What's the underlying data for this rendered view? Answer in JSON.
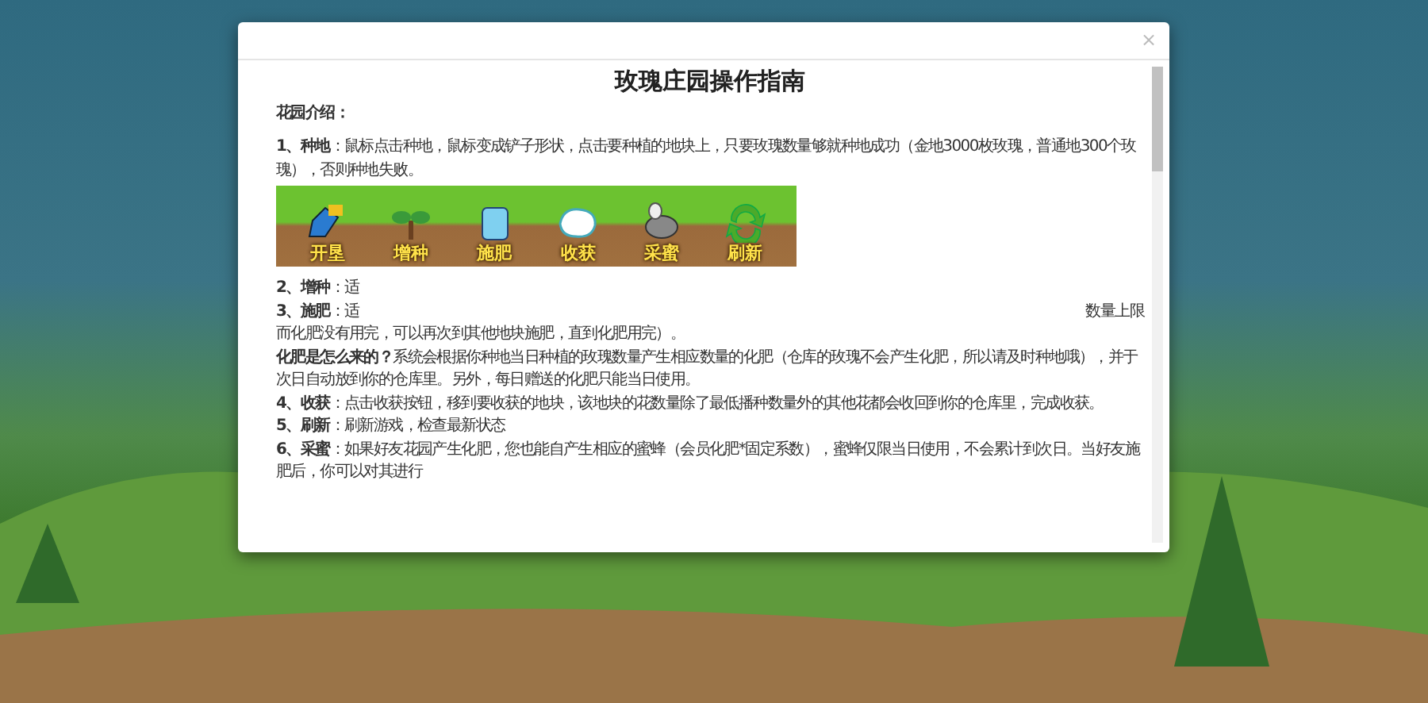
{
  "dialog": {
    "close": "×",
    "title": "玫瑰庄园操作指南",
    "sections": [
      {
        "kind": "heading",
        "text": "花园介绍："
      },
      {
        "kind": "gap"
      },
      {
        "kind": "item",
        "text": "**1、种地**：鼠标点击种地，鼠标变成铲子形状，点击要种植的地块上，只要玫瑰数量够就种地成功（金地3000枚玫瑰，普通地300个玫瑰），否则种地失败。"
      },
      {
        "kind": "toolbar",
        "buttons": [
          {
            "label": "开垦"
          },
          {
            "label": "增种"
          },
          {
            "label": "施肥"
          },
          {
            "label": "收获"
          },
          {
            "label": "采蜜"
          },
          {
            "label": "刷新"
          }
        ]
      },
      {
        "kind": "gap"
      },
      {
        "kind": "item",
        "text": "**2、增种**：适"
      },
      {
        "kind": "item",
        "text": "**3、施肥**：适",
        "aside": "数量上限"
      },
      {
        "kind": "item",
        "text": "而化肥没有用完，可以再次到其他地块施肥，直到化肥用完）。"
      },
      {
        "kind": "item",
        "text": "**化肥是怎么来的？**系统会根据你种地当日种植的玫瑰数量产生相应数量的化肥（仓库的玫瑰不会产生化肥，所以请及时种地哦），并于次日自动放到你的仓库里。另外，每日赠送的化肥只能当日使用。"
      },
      {
        "kind": "item",
        "text": "**4、收获**：点击收获按钮，移到要收获的地块，该地块的花数量除了最低播种数量外的其他花都会收回到你的仓库里，完成收获。"
      },
      {
        "kind": "item",
        "text": "**5、刷新**：刷新游戏，检查最新状态"
      },
      {
        "kind": "item",
        "text": "**6、采蜜**：如果好友花园产生化肥，您也能自产生相应的蜜蜂（会员化肥*固定系数），蜜蜂仅限当日使用，不会累计到次日。当好友施肥后，你可以对其进行"
      }
    ]
  }
}
